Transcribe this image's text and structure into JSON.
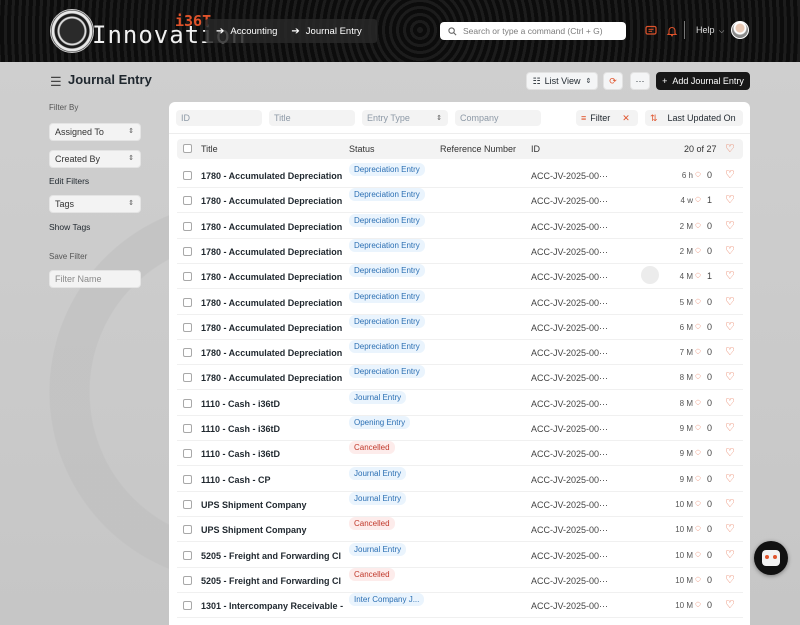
{
  "nav": {
    "logo_text": "Innovation",
    "logo_badge": "i36T",
    "breadcrumbs": [
      "Accounting",
      "Journal Entry"
    ],
    "search_placeholder": "Search or type a command (Ctrl + G)",
    "help_label": "Help"
  },
  "page": {
    "title": "Journal Entry",
    "list_view_label": "List View",
    "more_label": "···",
    "add_label": "Add Journal Entry"
  },
  "sidebar": {
    "filter_by": "Filter By",
    "assigned_to": "Assigned To",
    "created_by": "Created By",
    "edit_filters": "Edit Filters",
    "tags": "Tags",
    "show_tags": "Show Tags",
    "save_filter": "Save Filter",
    "filter_name_placeholder": "Filter Name"
  },
  "filters": {
    "id_placeholder": "ID",
    "title_placeholder": "Title",
    "entry_type_placeholder": "Entry Type",
    "company_placeholder": "Company",
    "filter_label": "Filter",
    "sort_label": "Last Updated On"
  },
  "columns": {
    "title": "Title",
    "status": "Status",
    "reference": "Reference Number",
    "id": "ID",
    "count": "20 of 27"
  },
  "rows": [
    {
      "title": "1780 - Accumulated Depreciation",
      "status": "Depreciation Entry",
      "color": "blue",
      "id": "ACC-JV-2025-00···",
      "modified": "6 h",
      "comments": "0"
    },
    {
      "title": "1780 - Accumulated Depreciation",
      "status": "Depreciation Entry",
      "color": "blue",
      "id": "ACC-JV-2025-00···",
      "modified": "4 w",
      "comments": "1"
    },
    {
      "title": "1780 - Accumulated Depreciation",
      "status": "Depreciation Entry",
      "color": "blue",
      "id": "ACC-JV-2025-00···",
      "modified": "2 M",
      "comments": "0"
    },
    {
      "title": "1780 - Accumulated Depreciation",
      "status": "Depreciation Entry",
      "color": "blue",
      "id": "ACC-JV-2025-00···",
      "modified": "2 M",
      "comments": "0"
    },
    {
      "title": "1780 - Accumulated Depreciation",
      "status": "Depreciation Entry",
      "color": "blue",
      "id": "ACC-JV-2025-00···",
      "modified": "4 M",
      "comments": "1"
    },
    {
      "title": "1780 - Accumulated Depreciation",
      "status": "Depreciation Entry",
      "color": "blue",
      "id": "ACC-JV-2025-00···",
      "modified": "5 M",
      "comments": "0"
    },
    {
      "title": "1780 - Accumulated Depreciation",
      "status": "Depreciation Entry",
      "color": "blue",
      "id": "ACC-JV-2025-00···",
      "modified": "6 M",
      "comments": "0"
    },
    {
      "title": "1780 - Accumulated Depreciation",
      "status": "Depreciation Entry",
      "color": "blue",
      "id": "ACC-JV-2025-00···",
      "modified": "7 M",
      "comments": "0"
    },
    {
      "title": "1780 - Accumulated Depreciation",
      "status": "Depreciation Entry",
      "color": "blue",
      "id": "ACC-JV-2025-00···",
      "modified": "8 M",
      "comments": "0"
    },
    {
      "title": "1110 - Cash - i36tD",
      "status": "Journal Entry",
      "color": "blue",
      "id": "ACC-JV-2025-00···",
      "modified": "8 M",
      "comments": "0"
    },
    {
      "title": "1110 - Cash - i36tD",
      "status": "Opening Entry",
      "color": "blue",
      "id": "ACC-JV-2025-00···",
      "modified": "9 M",
      "comments": "0"
    },
    {
      "title": "1110 - Cash - i36tD",
      "status": "Cancelled",
      "color": "red",
      "id": "ACC-JV-2025-00···",
      "modified": "9 M",
      "comments": "0"
    },
    {
      "title": "1110 - Cash - CP",
      "status": "Journal Entry",
      "color": "blue",
      "id": "ACC-JV-2025-00···",
      "modified": "9 M",
      "comments": "0"
    },
    {
      "title": "UPS Shipment Company",
      "status": "Journal Entry",
      "color": "blue",
      "id": "ACC-JV-2025-00···",
      "modified": "10 M",
      "comments": "0"
    },
    {
      "title": "UPS Shipment Company",
      "status": "Cancelled",
      "color": "red",
      "id": "ACC-JV-2025-00···",
      "modified": "10 M",
      "comments": "0"
    },
    {
      "title": "5205 - Freight and Forwarding Cl",
      "status": "Journal Entry",
      "color": "blue",
      "id": "ACC-JV-2025-00···",
      "modified": "10 M",
      "comments": "0"
    },
    {
      "title": "5205 - Freight and Forwarding Cl",
      "status": "Cancelled",
      "color": "red",
      "id": "ACC-JV-2025-00···",
      "modified": "10 M",
      "comments": "0"
    },
    {
      "title": "1301 - Intercompany Receivable -",
      "status": "Inter Company J...",
      "color": "blue",
      "id": "ACC-JV-2025-00···",
      "modified": "10 M",
      "comments": "0"
    }
  ]
}
